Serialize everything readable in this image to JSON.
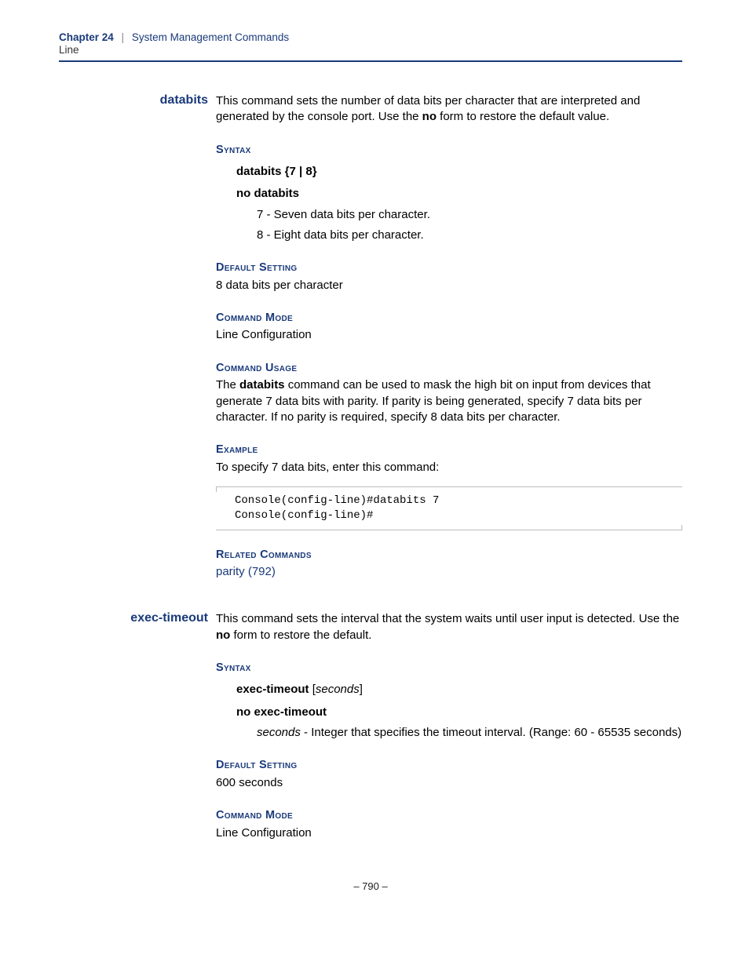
{
  "header": {
    "chapter_label": "Chapter 24",
    "separator": "|",
    "chapter_title": "System Management Commands",
    "subtitle": "Line"
  },
  "sections": {
    "databits": {
      "label": "databits",
      "intro_pre": "This command sets the number of data bits per character that are interpreted and generated by the console port. Use the ",
      "intro_bold": "no",
      "intro_post": " form to restore the default value.",
      "syntax_heading": "Syntax",
      "syntax_cmd": "databits",
      "syntax_args": " {7 | 8}",
      "syntax_no": "no databits",
      "param7": "7 - Seven data bits per character.",
      "param8": "8 - Eight data bits per character.",
      "default_heading": "Default Setting",
      "default_body": "8 data bits per character",
      "mode_heading": "Command Mode",
      "mode_body": "Line Configuration",
      "usage_heading": "Command Usage",
      "usage_pre": "The ",
      "usage_bold": "databits",
      "usage_post": " command can be used to mask the high bit on input from devices that generate 7 data bits with parity. If parity is being generated, specify 7 data bits per character. If no parity is required, specify 8 data bits per character.",
      "example_heading": "Example",
      "example_intro": "To specify 7 data bits, enter this command:",
      "example_code": "Console(config-line)#databits 7\nConsole(config-line)#",
      "related_heading": "Related Commands",
      "related_link": "parity (792)"
    },
    "exec_timeout": {
      "label": "exec-timeout",
      "intro_pre": "This command sets the interval that the system waits until user input is detected. Use the ",
      "intro_bold": "no",
      "intro_post": " form to restore the default.",
      "syntax_heading": "Syntax",
      "syntax_cmd": "exec-timeout",
      "syntax_arg_open": " [",
      "syntax_arg_ital": "seconds",
      "syntax_arg_close": "]",
      "syntax_no": "no exec-timeout",
      "param_ital": "seconds",
      "param_desc": " - Integer that specifies the timeout interval. (Range: 60 - 65535 seconds)",
      "default_heading": "Default Setting",
      "default_body": "600 seconds",
      "mode_heading": "Command Mode",
      "mode_body": "Line Configuration"
    }
  },
  "page_number": "–  790  –"
}
